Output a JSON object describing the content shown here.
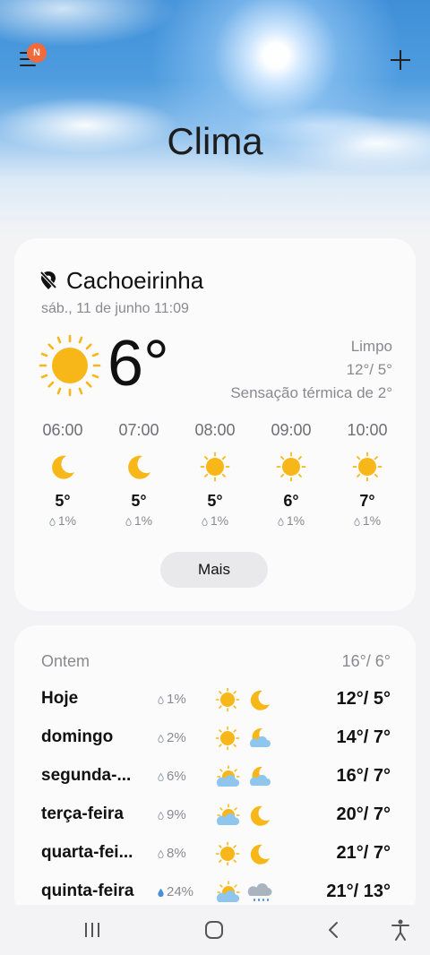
{
  "header": {
    "title": "Clima",
    "menu_icon": "hamburger-menu-icon",
    "badge": "N",
    "add_icon": "plus-icon"
  },
  "current": {
    "location": "Cachoeirinha",
    "location_icon": "location-off-icon",
    "datetime": "sáb., 11 de junho 11:09",
    "temperature": "6°",
    "icon": "sun-icon",
    "condition": "Limpo",
    "high_low": "12°/ 5°",
    "feels_like": "Sensação térmica de 2°"
  },
  "hourly": [
    {
      "time": "06:00",
      "icon": "moon-icon",
      "temp": "5°",
      "precip": "1%"
    },
    {
      "time": "07:00",
      "icon": "moon-icon",
      "temp": "5°",
      "precip": "1%"
    },
    {
      "time": "08:00",
      "icon": "sun-icon",
      "temp": "5°",
      "precip": "1%"
    },
    {
      "time": "09:00",
      "icon": "sun-icon",
      "temp": "6°",
      "precip": "1%"
    },
    {
      "time": "10:00",
      "icon": "sun-icon",
      "temp": "7°",
      "precip": "1%"
    }
  ],
  "more_label": "Mais",
  "yesterday": {
    "label": "Ontem",
    "temps": "16°/ 6°"
  },
  "daily": [
    {
      "day": "Hoje",
      "precip": "1%",
      "day_icon": "sun-icon",
      "night_icon": "moon-icon",
      "temps": "12°/ 5°"
    },
    {
      "day": "domingo",
      "precip": "2%",
      "day_icon": "sun-icon",
      "night_icon": "moon-cloud-icon",
      "temps": "14°/ 7°"
    },
    {
      "day": "segunda-...",
      "precip": "6%",
      "day_icon": "sun-cloud-icon",
      "night_icon": "moon-cloud-icon",
      "temps": "16°/ 7°"
    },
    {
      "day": "terça-feira",
      "precip": "9%",
      "day_icon": "sun-cloud-icon",
      "night_icon": "moon-icon",
      "temps": "20°/ 7°"
    },
    {
      "day": "quarta-fei...",
      "precip": "8%",
      "day_icon": "sun-icon",
      "night_icon": "moon-icon",
      "temps": "21°/ 7°"
    },
    {
      "day": "quinta-feira",
      "precip": "24%",
      "day_icon": "sun-cloud-icon",
      "night_icon": "rain-cloud-icon",
      "temps": "21°/ 13°"
    }
  ],
  "navbar": {
    "recents_icon": "recent-apps-icon",
    "home_icon": "home-icon",
    "back_icon": "back-icon",
    "accessibility_icon": "accessibility-icon"
  },
  "colors": {
    "sun": "#f8b718",
    "moon": "#f8b718",
    "cloud": "#8fc6ee",
    "badge": "#f06a3c",
    "card": "#fbfbfc",
    "background": "#f3f3f5"
  }
}
